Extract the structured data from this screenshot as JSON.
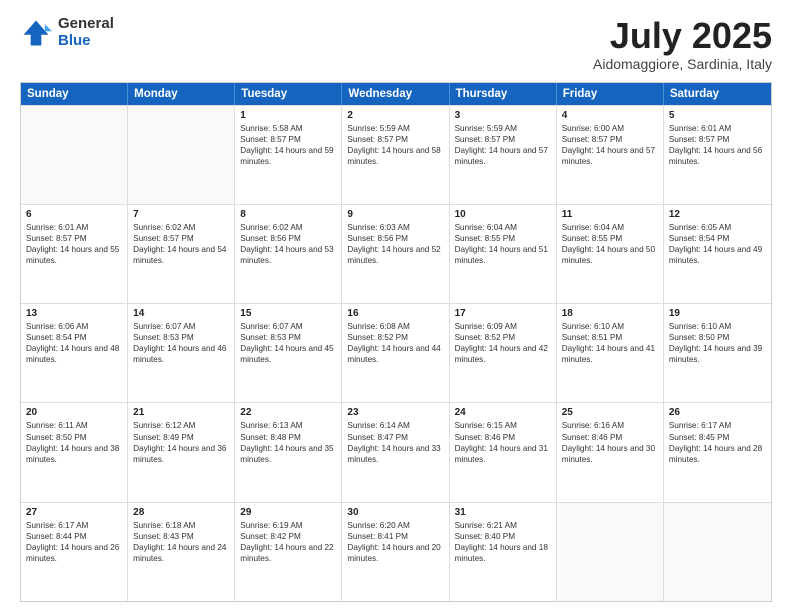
{
  "logo": {
    "general": "General",
    "blue": "Blue"
  },
  "title": "July 2025",
  "subtitle": "Aidomaggiore, Sardinia, Italy",
  "headers": [
    "Sunday",
    "Monday",
    "Tuesday",
    "Wednesday",
    "Thursday",
    "Friday",
    "Saturday"
  ],
  "rows": [
    [
      {
        "day": "",
        "empty": true
      },
      {
        "day": "",
        "empty": true
      },
      {
        "day": "1",
        "sunrise": "Sunrise: 5:58 AM",
        "sunset": "Sunset: 8:57 PM",
        "daylight": "Daylight: 14 hours and 59 minutes."
      },
      {
        "day": "2",
        "sunrise": "Sunrise: 5:59 AM",
        "sunset": "Sunset: 8:57 PM",
        "daylight": "Daylight: 14 hours and 58 minutes."
      },
      {
        "day": "3",
        "sunrise": "Sunrise: 5:59 AM",
        "sunset": "Sunset: 8:57 PM",
        "daylight": "Daylight: 14 hours and 57 minutes."
      },
      {
        "day": "4",
        "sunrise": "Sunrise: 6:00 AM",
        "sunset": "Sunset: 8:57 PM",
        "daylight": "Daylight: 14 hours and 57 minutes."
      },
      {
        "day": "5",
        "sunrise": "Sunrise: 6:01 AM",
        "sunset": "Sunset: 8:57 PM",
        "daylight": "Daylight: 14 hours and 56 minutes."
      }
    ],
    [
      {
        "day": "6",
        "sunrise": "Sunrise: 6:01 AM",
        "sunset": "Sunset: 8:57 PM",
        "daylight": "Daylight: 14 hours and 55 minutes."
      },
      {
        "day": "7",
        "sunrise": "Sunrise: 6:02 AM",
        "sunset": "Sunset: 8:57 PM",
        "daylight": "Daylight: 14 hours and 54 minutes."
      },
      {
        "day": "8",
        "sunrise": "Sunrise: 6:02 AM",
        "sunset": "Sunset: 8:56 PM",
        "daylight": "Daylight: 14 hours and 53 minutes."
      },
      {
        "day": "9",
        "sunrise": "Sunrise: 6:03 AM",
        "sunset": "Sunset: 8:56 PM",
        "daylight": "Daylight: 14 hours and 52 minutes."
      },
      {
        "day": "10",
        "sunrise": "Sunrise: 6:04 AM",
        "sunset": "Sunset: 8:55 PM",
        "daylight": "Daylight: 14 hours and 51 minutes."
      },
      {
        "day": "11",
        "sunrise": "Sunrise: 6:04 AM",
        "sunset": "Sunset: 8:55 PM",
        "daylight": "Daylight: 14 hours and 50 minutes."
      },
      {
        "day": "12",
        "sunrise": "Sunrise: 6:05 AM",
        "sunset": "Sunset: 8:54 PM",
        "daylight": "Daylight: 14 hours and 49 minutes."
      }
    ],
    [
      {
        "day": "13",
        "sunrise": "Sunrise: 6:06 AM",
        "sunset": "Sunset: 8:54 PM",
        "daylight": "Daylight: 14 hours and 48 minutes."
      },
      {
        "day": "14",
        "sunrise": "Sunrise: 6:07 AM",
        "sunset": "Sunset: 8:53 PM",
        "daylight": "Daylight: 14 hours and 46 minutes."
      },
      {
        "day": "15",
        "sunrise": "Sunrise: 6:07 AM",
        "sunset": "Sunset: 8:53 PM",
        "daylight": "Daylight: 14 hours and 45 minutes."
      },
      {
        "day": "16",
        "sunrise": "Sunrise: 6:08 AM",
        "sunset": "Sunset: 8:52 PM",
        "daylight": "Daylight: 14 hours and 44 minutes."
      },
      {
        "day": "17",
        "sunrise": "Sunrise: 6:09 AM",
        "sunset": "Sunset: 8:52 PM",
        "daylight": "Daylight: 14 hours and 42 minutes."
      },
      {
        "day": "18",
        "sunrise": "Sunrise: 6:10 AM",
        "sunset": "Sunset: 8:51 PM",
        "daylight": "Daylight: 14 hours and 41 minutes."
      },
      {
        "day": "19",
        "sunrise": "Sunrise: 6:10 AM",
        "sunset": "Sunset: 8:50 PM",
        "daylight": "Daylight: 14 hours and 39 minutes."
      }
    ],
    [
      {
        "day": "20",
        "sunrise": "Sunrise: 6:11 AM",
        "sunset": "Sunset: 8:50 PM",
        "daylight": "Daylight: 14 hours and 38 minutes."
      },
      {
        "day": "21",
        "sunrise": "Sunrise: 6:12 AM",
        "sunset": "Sunset: 8:49 PM",
        "daylight": "Daylight: 14 hours and 36 minutes."
      },
      {
        "day": "22",
        "sunrise": "Sunrise: 6:13 AM",
        "sunset": "Sunset: 8:48 PM",
        "daylight": "Daylight: 14 hours and 35 minutes."
      },
      {
        "day": "23",
        "sunrise": "Sunrise: 6:14 AM",
        "sunset": "Sunset: 8:47 PM",
        "daylight": "Daylight: 14 hours and 33 minutes."
      },
      {
        "day": "24",
        "sunrise": "Sunrise: 6:15 AM",
        "sunset": "Sunset: 8:46 PM",
        "daylight": "Daylight: 14 hours and 31 minutes."
      },
      {
        "day": "25",
        "sunrise": "Sunrise: 6:16 AM",
        "sunset": "Sunset: 8:46 PM",
        "daylight": "Daylight: 14 hours and 30 minutes."
      },
      {
        "day": "26",
        "sunrise": "Sunrise: 6:17 AM",
        "sunset": "Sunset: 8:45 PM",
        "daylight": "Daylight: 14 hours and 28 minutes."
      }
    ],
    [
      {
        "day": "27",
        "sunrise": "Sunrise: 6:17 AM",
        "sunset": "Sunset: 8:44 PM",
        "daylight": "Daylight: 14 hours and 26 minutes."
      },
      {
        "day": "28",
        "sunrise": "Sunrise: 6:18 AM",
        "sunset": "Sunset: 8:43 PM",
        "daylight": "Daylight: 14 hours and 24 minutes."
      },
      {
        "day": "29",
        "sunrise": "Sunrise: 6:19 AM",
        "sunset": "Sunset: 8:42 PM",
        "daylight": "Daylight: 14 hours and 22 minutes."
      },
      {
        "day": "30",
        "sunrise": "Sunrise: 6:20 AM",
        "sunset": "Sunset: 8:41 PM",
        "daylight": "Daylight: 14 hours and 20 minutes."
      },
      {
        "day": "31",
        "sunrise": "Sunrise: 6:21 AM",
        "sunset": "Sunset: 8:40 PM",
        "daylight": "Daylight: 14 hours and 18 minutes."
      },
      {
        "day": "",
        "empty": true
      },
      {
        "day": "",
        "empty": true
      }
    ]
  ]
}
